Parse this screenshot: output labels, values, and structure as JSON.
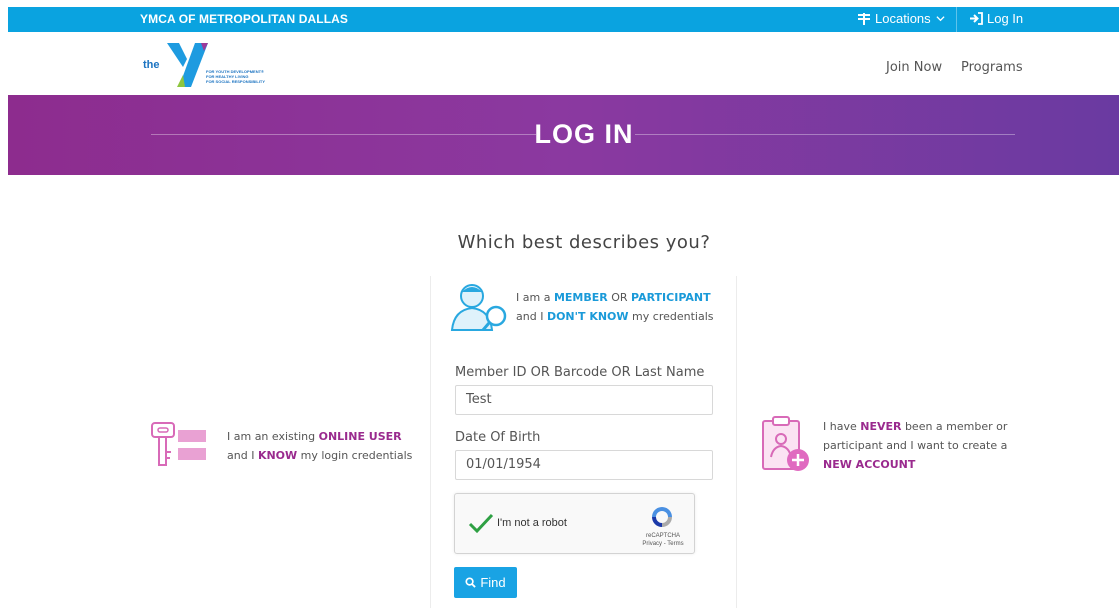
{
  "topbar": {
    "org_name": "YMCA OF METROPOLITAN DALLAS",
    "locations_label": "Locations",
    "login_label": "Log In"
  },
  "logo": {
    "the": "the",
    "tagline": [
      "FOR YOUTH DEVELOPMENT®",
      "FOR HEALTHY LIVING",
      "FOR SOCIAL RESPONSIBILITY"
    ]
  },
  "nav": {
    "join_now": "Join Now",
    "programs": "Programs"
  },
  "banner": {
    "title": "LOG IN"
  },
  "page": {
    "question": "Which best describes you?"
  },
  "options": {
    "online_user": {
      "l1a": "I am an existing ",
      "l1b": "ONLINE USER",
      "l2a": "and I ",
      "l2b": "KNOW",
      "l2c": " my login credentials"
    },
    "member": {
      "l1a": "I am a ",
      "l1b": "MEMBER",
      "l1c": " OR ",
      "l1d": "PARTICIPANT",
      "l2a": "and I ",
      "l2b": "DON'T KNOW",
      "l2c": " my credentials"
    },
    "new_account": {
      "l1a": "I have ",
      "l1b": "NEVER",
      "l1c": " been a member or",
      "l2": "participant and I want to create a",
      "l3": "NEW ACCOUNT"
    }
  },
  "form": {
    "member_id_label": "Member ID OR Barcode OR Last Name",
    "member_id_value": "Test",
    "dob_label": "Date Of Birth",
    "dob_value": "01/01/1954",
    "find_label": "Find"
  },
  "captcha": {
    "label": "I'm not a robot",
    "brand": "reCAPTCHA",
    "links": "Privacy - Terms"
  },
  "colors": {
    "topbar": "#0aa3e0",
    "banner_start": "#8d2c8e",
    "banner_end": "#6a3aa1",
    "member_blue": "#1a9ad9",
    "online_purple": "#9a2a8e",
    "find_button": "#19a3e4"
  }
}
